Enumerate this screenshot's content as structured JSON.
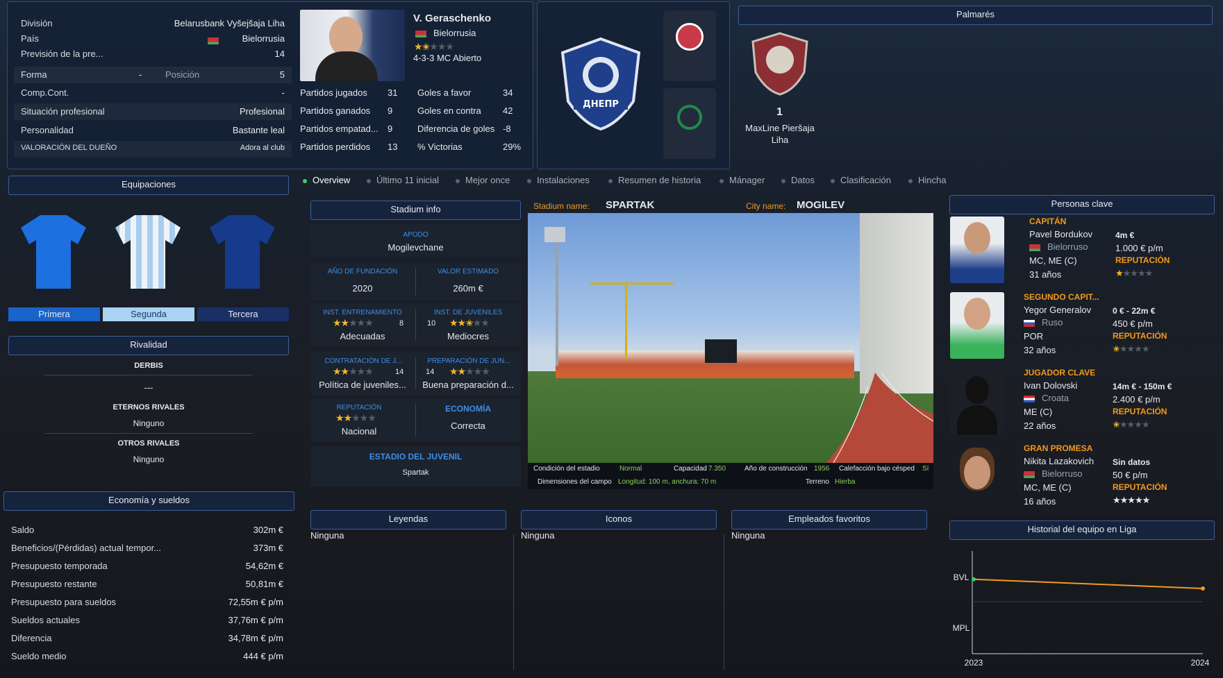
{
  "club": {
    "division_label": "División",
    "division": "Belarusbank Vyšejšaja Liha",
    "country_label": "País",
    "country": "Bielorrusia",
    "prediction_label": "Previsión de la pre...",
    "prediction": "14",
    "form_label": "Forma",
    "form": "-",
    "position_label": "Posición",
    "position": "5",
    "comp_label": "Comp.Cont.",
    "comp": "-",
    "pro_label": "Situación profesional",
    "pro": "Profesional",
    "pers_label": "Personalidad",
    "pers": "Bastante leal",
    "owner_label": "VALORACIÓN DEL DUEÑO",
    "owner": "Adora al club"
  },
  "manager": {
    "name": "V. Geraschenko",
    "nation": "Bielorrusia",
    "tactic": "4-3-3 MC Abierto",
    "stars": 1.5
  },
  "stats": [
    {
      "l": "Partidos jugados",
      "v": "31",
      "l2": "Goles a favor",
      "v2": "34"
    },
    {
      "l": "Partidos ganados",
      "v": "9",
      "l2": "Goles en contra",
      "v2": "42"
    },
    {
      "l": "Partidos empatad...",
      "v": "9",
      "l2": "Diferencia de goles",
      "v2": "-8"
    },
    {
      "l": "Partidos perdidos",
      "v": "13",
      "l2": "% Victorias",
      "v2": "29%"
    }
  ],
  "palmares": {
    "title": "Palmarés",
    "count": "1",
    "name": "MaxLine Pieršaja Liha"
  },
  "kits": {
    "title": "Equipaciones",
    "first": "Primera",
    "second": "Segunda",
    "third": "Tercera"
  },
  "rivals": {
    "title": "Rivalidad",
    "derbis": "DERBIS",
    "derbis_val": "---",
    "eternos": "ETERNOS RIVALES",
    "eternos_val": "Ninguno",
    "otros": "OTROS RIVALES",
    "otros_val": "Ninguno"
  },
  "economy": {
    "title": "Economía y sueldos",
    "rows": [
      {
        "l": "Saldo",
        "v": "302m €"
      },
      {
        "l": "Beneficios/(Pérdidas) actual tempor...",
        "v": "373m €"
      },
      {
        "l": "Presupuesto temporada",
        "v": "54,62m €"
      },
      {
        "l": "Presupuesto restante",
        "v": "50,81m €"
      },
      {
        "l": "Presupuesto para sueldos",
        "v": "72,55m € p/m"
      },
      {
        "l": "Sueldos actuales",
        "v": "37,76m € p/m"
      },
      {
        "l": "Diferencia",
        "v": "34,78m € p/m"
      },
      {
        "l": "Sueldo medio",
        "v": "444 € p/m"
      }
    ]
  },
  "tabs": [
    "Overview",
    "Último 11 inicial",
    "Mejor once",
    "Instalaciones",
    "Resumen de historia",
    "Mánager",
    "Datos",
    "Clasificación",
    "Hincha"
  ],
  "stadium": {
    "title": "Stadium info",
    "apodo_l": "APODO",
    "apodo": "Mogilevchane",
    "fund_l": "AÑO DE FUNDACIÓN",
    "fund": "2020",
    "valor_l": "VALOR ESTIMADO",
    "valor": "260m €",
    "ent_l": "INST. ENTRENAMIENTO",
    "ent": "Adecuadas",
    "ent_n": "8",
    "juv_l": "INST. DE JUVENILES",
    "juv": "Mediocres",
    "juv_n": "10",
    "con_l": "CONTRATACIÓN DE J...",
    "con": "Política de juveniles...",
    "con_n": "14",
    "prep_l": "PREPARACIÓN DE JUN...",
    "prep": "Buena preparación d...",
    "prep_n": "14",
    "rep_l": "REPUTACIÓN",
    "rep": "Nacional",
    "eco_l": "ECONOMÍA",
    "eco": "Correcta",
    "juvstad_l": "ESTADIO DEL JUVENIL",
    "juvstad": "Spartak",
    "name_l": "Stadium name:",
    "name": "SPARTAK",
    "city_l": "City name:",
    "city": "MOGILEV",
    "cond_l": "Condición del estadio",
    "cond": "Normal",
    "cap_l": "Capacidad",
    "cap": "7.350",
    "year_l": "Año de construcción",
    "year": "1956",
    "heat_l": "Calefacción bajo césped",
    "heat": "Sí",
    "dim_l": "Dimensiones del campo",
    "dim": "Longitud: 100 m, anchura: 70 m",
    "turf_l": "Terreno",
    "turf": "Hierba"
  },
  "lists": {
    "leyendas": "Leyendas",
    "iconos": "Iconos",
    "empleados": "Empleados favoritos",
    "none": "Ninguna"
  },
  "key": {
    "title": "Personas clave",
    "people": [
      {
        "role": "CAPITÁN",
        "name": "Pavel Bordukov",
        "nat": "Bielorruso",
        "pos": "MC, ME (C)",
        "age": "31 años",
        "val": "4m €",
        "wage": "1.000 € p/m",
        "rep": "REPUTACIÓN",
        "stars": 1
      },
      {
        "role": "SEGUNDO CAPIT...",
        "name": "Yegor Generalov",
        "nat": "Ruso",
        "pos": "POR",
        "age": "32 años",
        "val": "0 € - 22m €",
        "wage": "450 € p/m",
        "rep": "REPUTACIÓN",
        "stars": 0.5
      },
      {
        "role": "JUGADOR CLAVE",
        "name": "Ivan Dolovski",
        "nat": "Croata",
        "pos": "ME (C)",
        "age": "22 años",
        "val": "14m € - 150m €",
        "wage": "2.400 € p/m",
        "rep": "REPUTACIÓN",
        "stars": 0.5
      },
      {
        "role": "GRAN PROMESA",
        "name": "Nikita Lazakovich",
        "nat": "Bielorruso",
        "pos": "MC, ME (C)",
        "age": "16 años",
        "val": "Sin datos",
        "wage": "50 € p/m",
        "rep": "REPUTACIÓN",
        "stars": 5
      }
    ]
  },
  "history": {
    "title": "Historial del equipo en Liga",
    "y1": "BVL",
    "y2": "MPL",
    "x1": "2023",
    "x2": "2024"
  },
  "chart_data": {
    "type": "line",
    "x": [
      "2023",
      "2024"
    ],
    "y_categories": [
      "BVL",
      "MPL"
    ],
    "series": [
      {
        "values": [
          1.45,
          1.27
        ]
      }
    ]
  },
  "colors": {
    "accent": "#3e8ee8",
    "orange": "#f39a1a",
    "star": "#f2b82a"
  }
}
